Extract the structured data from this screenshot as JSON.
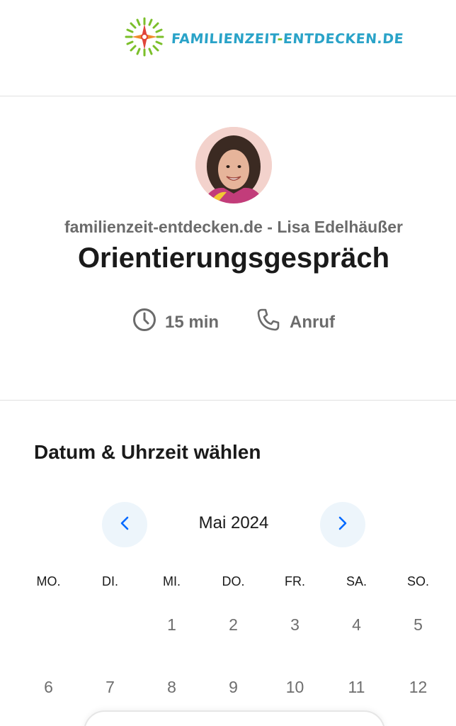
{
  "header": {
    "logo_text": "FAMILIENZEIT",
    "logo_dash": "-",
    "logo_text2": "ENTDECKEN.DE",
    "logo_icon": "compass-rose-icon"
  },
  "profile": {
    "org_name": "familienzeit-entdecken.de - Lisa Edelhäußer",
    "event_title": "Orientierungsgespräch",
    "duration": "15 min",
    "duration_icon": "clock-icon",
    "location": "Anruf",
    "location_icon": "phone-icon"
  },
  "calendar": {
    "heading": "Datum & Uhrzeit wählen",
    "month_label": "Mai 2024",
    "weekdays": [
      "MO.",
      "DI.",
      "MI.",
      "DO.",
      "FR.",
      "SA.",
      "SO."
    ],
    "week1": [
      "",
      "",
      "1",
      "2",
      "3",
      "4",
      "5"
    ],
    "week2": [
      "6",
      "7",
      "8",
      "9",
      "10",
      "11",
      "12"
    ]
  },
  "colors": {
    "accent_blue": "#0069ff",
    "nav_bg": "#edf5fb",
    "logo_blue": "#2aa3c8",
    "logo_green": "#7bbf2a",
    "logo_red": "#e0443a"
  }
}
